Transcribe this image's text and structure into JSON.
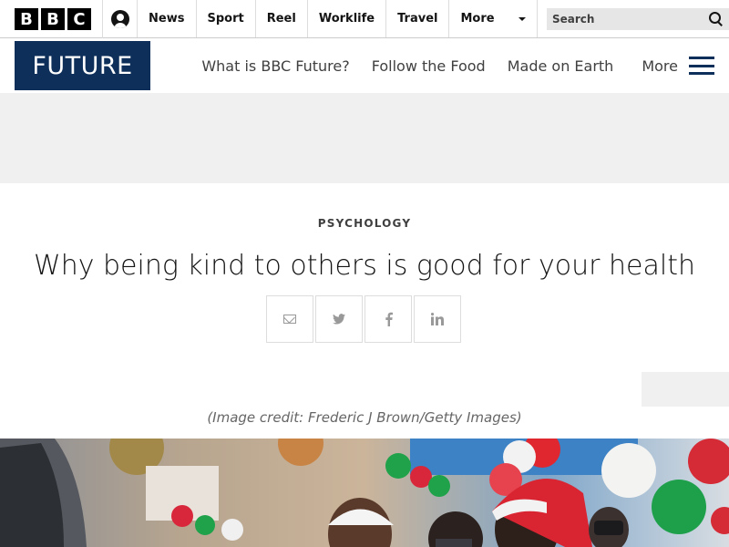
{
  "topbar": {
    "logo_letters": [
      "B",
      "B",
      "C"
    ],
    "nav": [
      "News",
      "Sport",
      "Reel",
      "Worklife",
      "Travel"
    ],
    "more_label": "More",
    "search_placeholder": "Search"
  },
  "future": {
    "logo": "FUTURE",
    "nav": [
      "What is BBC Future?",
      "Follow the Food",
      "Made on Earth"
    ],
    "more_label": "More"
  },
  "article": {
    "category": "PSYCHOLOGY",
    "headline": "Why being kind to others is good for your health",
    "image_credit": "(Image credit: Frederic J Brown/Getty Images)"
  },
  "share": [
    "email-icon",
    "twitter-icon",
    "facebook-icon",
    "linkedin-icon"
  ],
  "colors": {
    "future_blue": "#0e2f5a",
    "ad_grey": "#f0f0f0"
  }
}
